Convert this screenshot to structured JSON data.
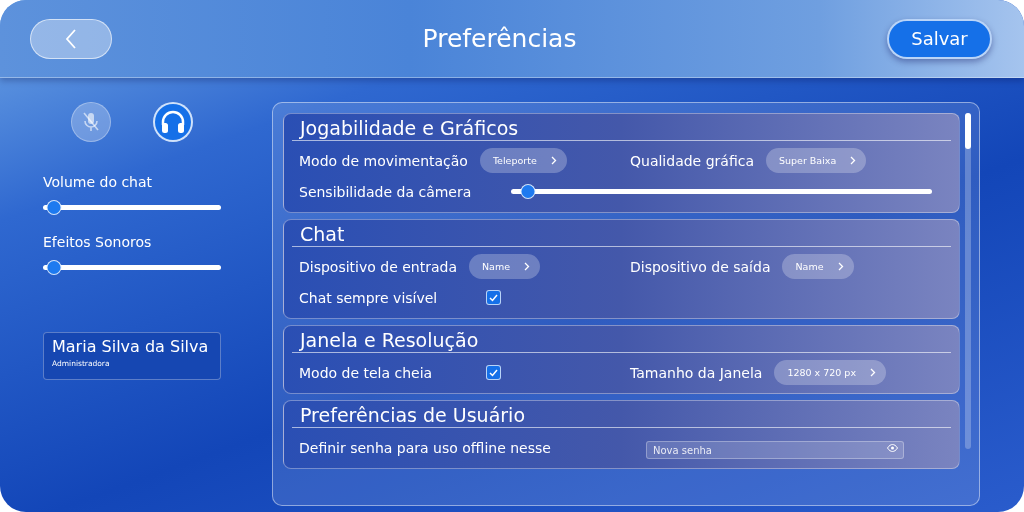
{
  "header": {
    "title": "Preferências",
    "save_button": "Salvar"
  },
  "audio_toggles": [
    {
      "kind": "microphone",
      "on": false
    },
    {
      "kind": "headphones",
      "on": true
    }
  ],
  "sliders": [
    {
      "label": "Volume do chat",
      "level": 0.06
    },
    {
      "label": "Efeitos Sonoros",
      "level": 0.06
    }
  ],
  "user": {
    "name": "Maria Silva da Silva",
    "role": "Administradora"
  },
  "sections": [
    {
      "title": "Jogabilidade e Gráficos",
      "rows": [
        [
          {
            "kind": "select",
            "label": "Modo de movimentação",
            "value": "Teleporte"
          },
          {
            "kind": "select",
            "label": "Qualidade gráfica",
            "value": "Super Baixa"
          }
        ],
        [
          {
            "kind": "slider",
            "label": "Sensibilidade da câmera",
            "level": 0.02
          }
        ]
      ]
    },
    {
      "title": "Chat",
      "rows": [
        [
          {
            "kind": "select",
            "label": "Dispositivo de entrada",
            "value": "Name"
          },
          {
            "kind": "select",
            "label": "Dispositivo de saída",
            "value": "Name"
          }
        ],
        [
          {
            "kind": "checkbox",
            "label": "Chat sempre visível",
            "checked": true
          }
        ]
      ]
    },
    {
      "title": "Janela e Resolução",
      "rows": [
        [
          {
            "kind": "checkbox",
            "label": "Modo de tela cheia",
            "checked": true
          },
          {
            "kind": "select",
            "label": "Tamanho da Janela",
            "value": "1280 x 720 px"
          }
        ]
      ]
    },
    {
      "title": "Preferências de Usuário",
      "rows": [
        [
          {
            "kind": "password",
            "label": "Definir senha para uso offline nesse",
            "placeholder": "Nova senha"
          }
        ]
      ]
    }
  ]
}
